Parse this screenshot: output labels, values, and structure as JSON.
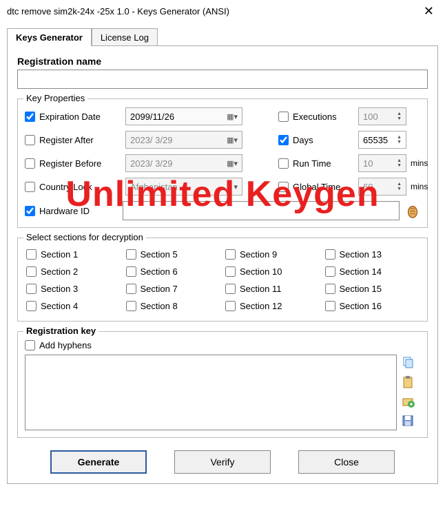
{
  "title": "dtc remove sim2k-24x -25x 1.0 - Keys Generator (ANSI)",
  "tabs": {
    "t0": "Keys Generator",
    "t1": "License Log"
  },
  "regname": {
    "label": "Registration name",
    "value": ""
  },
  "props": {
    "legend": "Key Properties",
    "expdate": {
      "label": "Expiration Date",
      "value": "2099/11/26"
    },
    "regafter": {
      "label": "Register After",
      "value": "2023/ 3/29"
    },
    "regbefore": {
      "label": "Register Before",
      "value": "2023/ 3/29"
    },
    "country": {
      "label": "Country Lock",
      "value": "Afghanistan"
    },
    "hwid": {
      "label": "Hardware ID",
      "value": ""
    },
    "exec": {
      "label": "Executions",
      "value": "100"
    },
    "days": {
      "label": "Days",
      "value": "65535"
    },
    "runtime": {
      "label": "Run Time",
      "value": "10",
      "unit": "mins"
    },
    "global": {
      "label": "Global Time",
      "value": "60",
      "unit": "mins"
    }
  },
  "sections": {
    "legend": "Select sections for decryption",
    "s1": "Section 1",
    "s2": "Section 2",
    "s3": "Section 3",
    "s4": "Section 4",
    "s5": "Section 5",
    "s6": "Section 6",
    "s7": "Section 7",
    "s8": "Section 8",
    "s9": "Section 9",
    "s10": "Section 10",
    "s11": "Section 11",
    "s12": "Section 12",
    "s13": "Section 13",
    "s14": "Section 14",
    "s15": "Section 15",
    "s16": "Section 16"
  },
  "regkey": {
    "label": "Registration key",
    "hyphens": "Add hyphens",
    "value": ""
  },
  "buttons": {
    "generate": "Generate",
    "verify": "Verify",
    "close": "Close"
  },
  "watermark": "Unlimited Keygen"
}
